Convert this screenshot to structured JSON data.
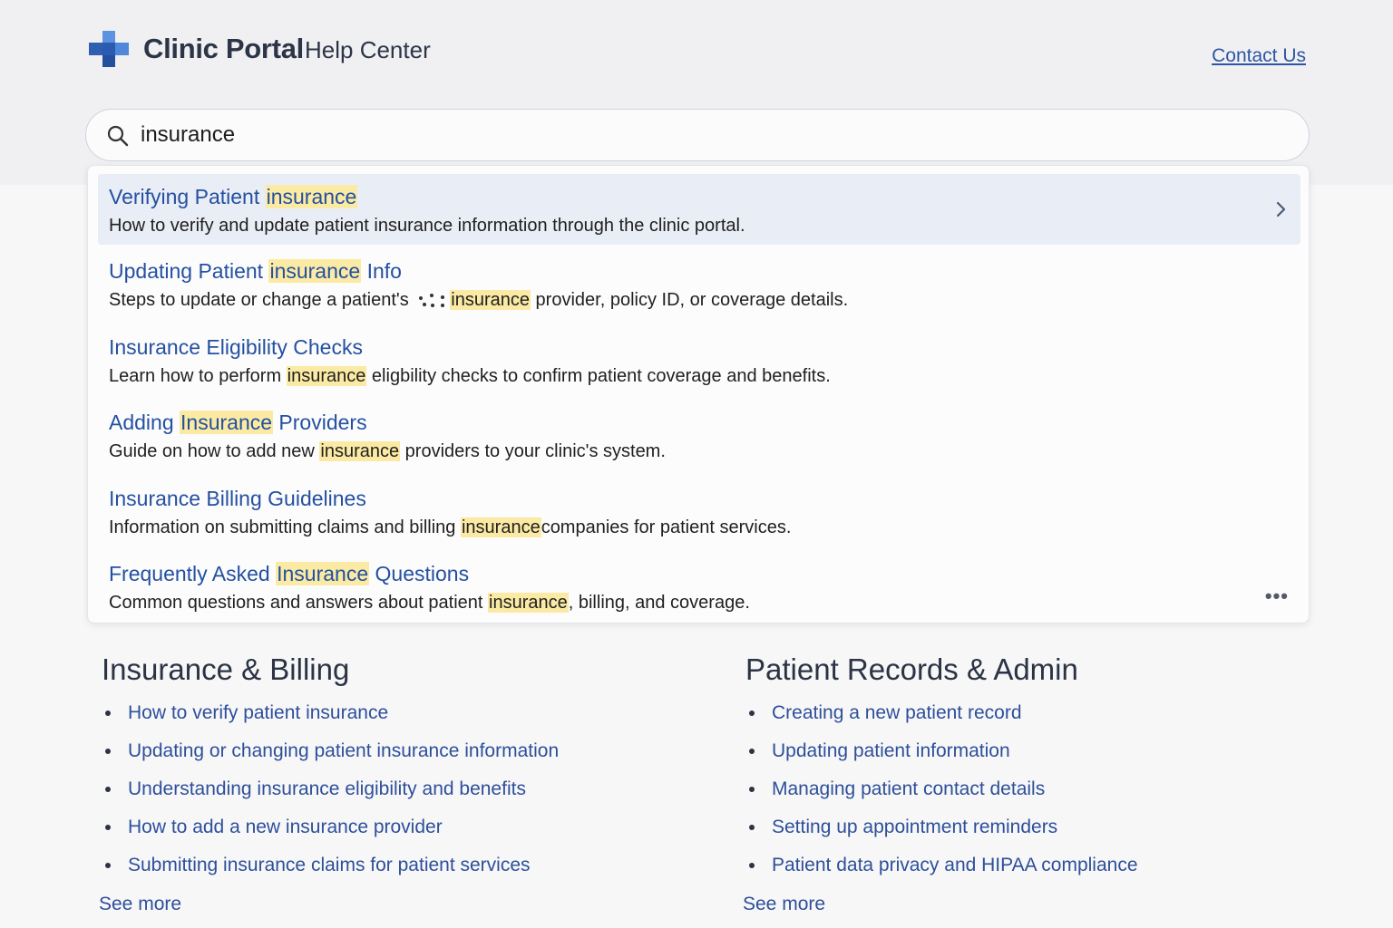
{
  "header": {
    "brand": "Clinic Portal",
    "subtitle": "Help Center",
    "contact_label": "Contact Us"
  },
  "search": {
    "value": "insurance",
    "placeholder": ""
  },
  "results": [
    {
      "title_parts": [
        "Verifying Patient ",
        "insurance",
        ""
      ],
      "desc_parts": [
        "How to verify and update patient insurance information through the clinic portal.",
        "",
        ""
      ]
    },
    {
      "title_parts": [
        "Updating Patient ",
        "insurance",
        " Info"
      ],
      "desc_before": "Steps to update or change a patient's ",
      "desc_mark": "insurance",
      "desc_after": " provider, policy ID, or coverage details."
    },
    {
      "title_parts": [
        "Insurance Eligibility Checks",
        "",
        ""
      ],
      "desc_parts": [
        "Learn how to perform ",
        "insurance",
        " eligbility checks to confirm patient coverage and benefits."
      ]
    },
    {
      "title_parts": [
        "Adding ",
        "Insurance",
        " Providers"
      ],
      "desc_parts": [
        "Guide on how to add new ",
        "insurance",
        " providers to your clinic's system."
      ]
    },
    {
      "title_parts": [
        "Insurance Billing Guidelines",
        "",
        ""
      ],
      "desc_parts": [
        "Information on submitting claims and billing ",
        "insurance",
        "companies for patient services."
      ]
    },
    {
      "title_parts": [
        "Frequently Asked ",
        "Insurance",
        " Questions"
      ],
      "desc_parts": [
        "Common questions and answers about patient ",
        "insurance",
        ", billing, and coverage."
      ]
    }
  ],
  "more_label": "•••",
  "sections": [
    {
      "title": "Insurance & Billing",
      "items": [
        "How to verify patient insurance",
        "Updating or changing patient insurance information",
        "Understanding insurance eligibility and benefits",
        "How to add a new insurance provider",
        "Submitting insurance claims for patient services"
      ],
      "see_more": "See more"
    },
    {
      "title": "Patient Records & Admin",
      "items": [
        "Creating a new patient record",
        "Updating patient information",
        "Managing patient contact details",
        "Setting up appointment reminders",
        "Patient data privacy and HIPAA compliance"
      ],
      "see_more": "See more"
    }
  ],
  "colors": {
    "link": "#2450a0",
    "highlight": "#fbeaa3",
    "active_row": "#e9edf5"
  }
}
